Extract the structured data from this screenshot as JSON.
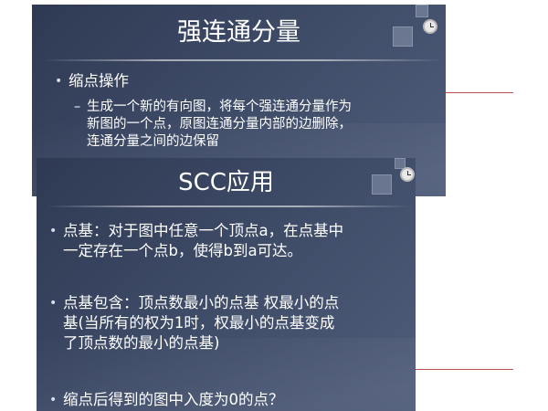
{
  "slide1": {
    "title": "强连通分量",
    "bullet": "缩点操作",
    "sub_bullet_lines": [
      "生成一个新的有向图，将每个强连通分量作为",
      "新图的一个点，原图连通分量内部的边删除，",
      "连通分量之间的边保留"
    ]
  },
  "slide2": {
    "title": "SCC应用",
    "bullets": [
      {
        "lines": [
          "点基：对于图中任意一个顶点a，在点基中",
          "一定存在一个点b，使得b到a可达。"
        ]
      },
      {
        "lines": [
          "点基包含：顶点数最小的点基 权最小的点",
          "基(当所有的权为1时，权最小的点基变成",
          "了顶点数的最小的点基)"
        ]
      },
      {
        "lines": [
          "缩点后得到的图中入度为0的点？"
        ]
      }
    ]
  },
  "icons": {
    "bullet": "•",
    "dash": "–",
    "clock": "clock-icon"
  },
  "colors": {
    "slide_background": "#3d4a66",
    "text": "#ffffff",
    "red_line": "#c0504d"
  }
}
